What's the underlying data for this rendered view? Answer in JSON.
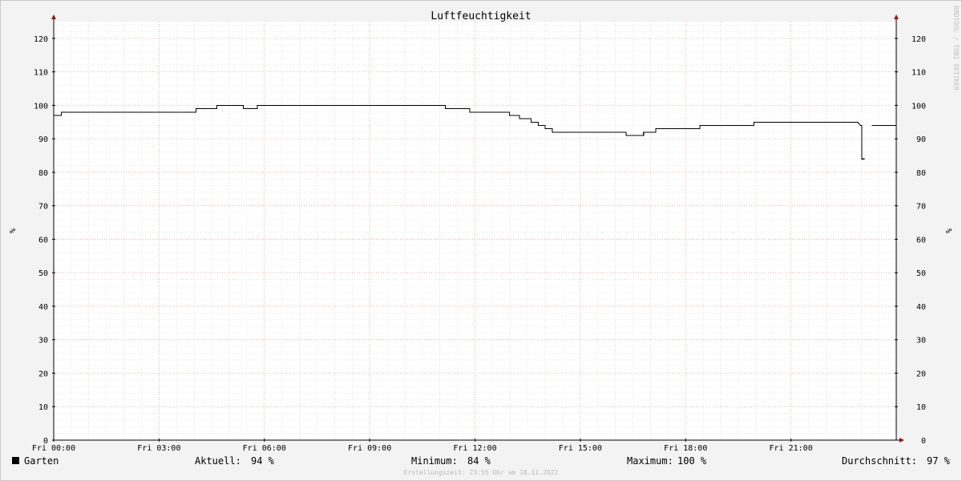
{
  "chart_data": {
    "type": "line",
    "title": "Luftfeuchtigkeit",
    "ylabel_left": "%",
    "ylabel_right": "%",
    "ylim": [
      0,
      125
    ],
    "y_ticks": [
      0,
      10,
      20,
      30,
      40,
      50,
      60,
      70,
      80,
      90,
      100,
      110,
      120
    ],
    "x_range_hours": [
      0,
      24
    ],
    "x_ticks": [
      {
        "hour": 0,
        "label": "Fri 00:00"
      },
      {
        "hour": 3,
        "label": "Fri 03:00"
      },
      {
        "hour": 6,
        "label": "Fri 06:00"
      },
      {
        "hour": 9,
        "label": "Fri 09:00"
      },
      {
        "hour": 12,
        "label": "Fri 12:00"
      },
      {
        "hour": 15,
        "label": "Fri 15:00"
      },
      {
        "hour": 18,
        "label": "Fri 18:00"
      },
      {
        "hour": 21,
        "label": "Fri 21:00"
      }
    ],
    "grid": true,
    "series": [
      {
        "name": "Garten",
        "color": "#000000",
        "segments": [
          [
            [
              0.0,
              97
            ],
            [
              0.22,
              97
            ],
            [
              0.22,
              98
            ],
            [
              4.05,
              98
            ],
            [
              4.05,
              99
            ],
            [
              4.65,
              99
            ],
            [
              4.65,
              100
            ],
            [
              5.4,
              100
            ],
            [
              5.4,
              99
            ],
            [
              5.8,
              99
            ],
            [
              5.8,
              100
            ],
            [
              11.15,
              100
            ],
            [
              11.15,
              99
            ],
            [
              11.85,
              99
            ],
            [
              11.85,
              98
            ],
            [
              12.98,
              98
            ],
            [
              12.98,
              97
            ],
            [
              13.27,
              97
            ],
            [
              13.27,
              96
            ],
            [
              13.6,
              96
            ],
            [
              13.6,
              95
            ],
            [
              13.8,
              95
            ],
            [
              13.8,
              94
            ],
            [
              14.0,
              94
            ],
            [
              14.0,
              93
            ],
            [
              14.2,
              93
            ],
            [
              14.2,
              92
            ],
            [
              16.3,
              92
            ],
            [
              16.3,
              91
            ],
            [
              16.8,
              91
            ],
            [
              16.8,
              92
            ],
            [
              17.15,
              92
            ],
            [
              17.15,
              93
            ],
            [
              18.4,
              93
            ],
            [
              18.4,
              94
            ],
            [
              19.95,
              94
            ],
            [
              19.95,
              95
            ],
            [
              22.9,
              95
            ],
            [
              22.98,
              94
            ],
            [
              23.02,
              94
            ],
            [
              23.02,
              84
            ],
            [
              23.1,
              84
            ]
          ],
          [
            [
              23.3,
              94
            ],
            [
              24.0,
              94
            ]
          ]
        ]
      }
    ],
    "legend": {
      "series_name": "Garten",
      "aktuell_label": "Aktuell:",
      "aktuell_value": "94 %",
      "minimum_label": "Minimum:",
      "minimum_value": "84 %",
      "maximum_label": "Maximum:",
      "maximum_value": "100 %",
      "durchschnitt_label": "Durchschnitt:",
      "durchschnitt_value": "97 %"
    },
    "footer": "Erstellungszeit: 23:55 Uhr am 18.11.2022",
    "watermark": "RRDTOOL / TOBI OETIKER"
  }
}
